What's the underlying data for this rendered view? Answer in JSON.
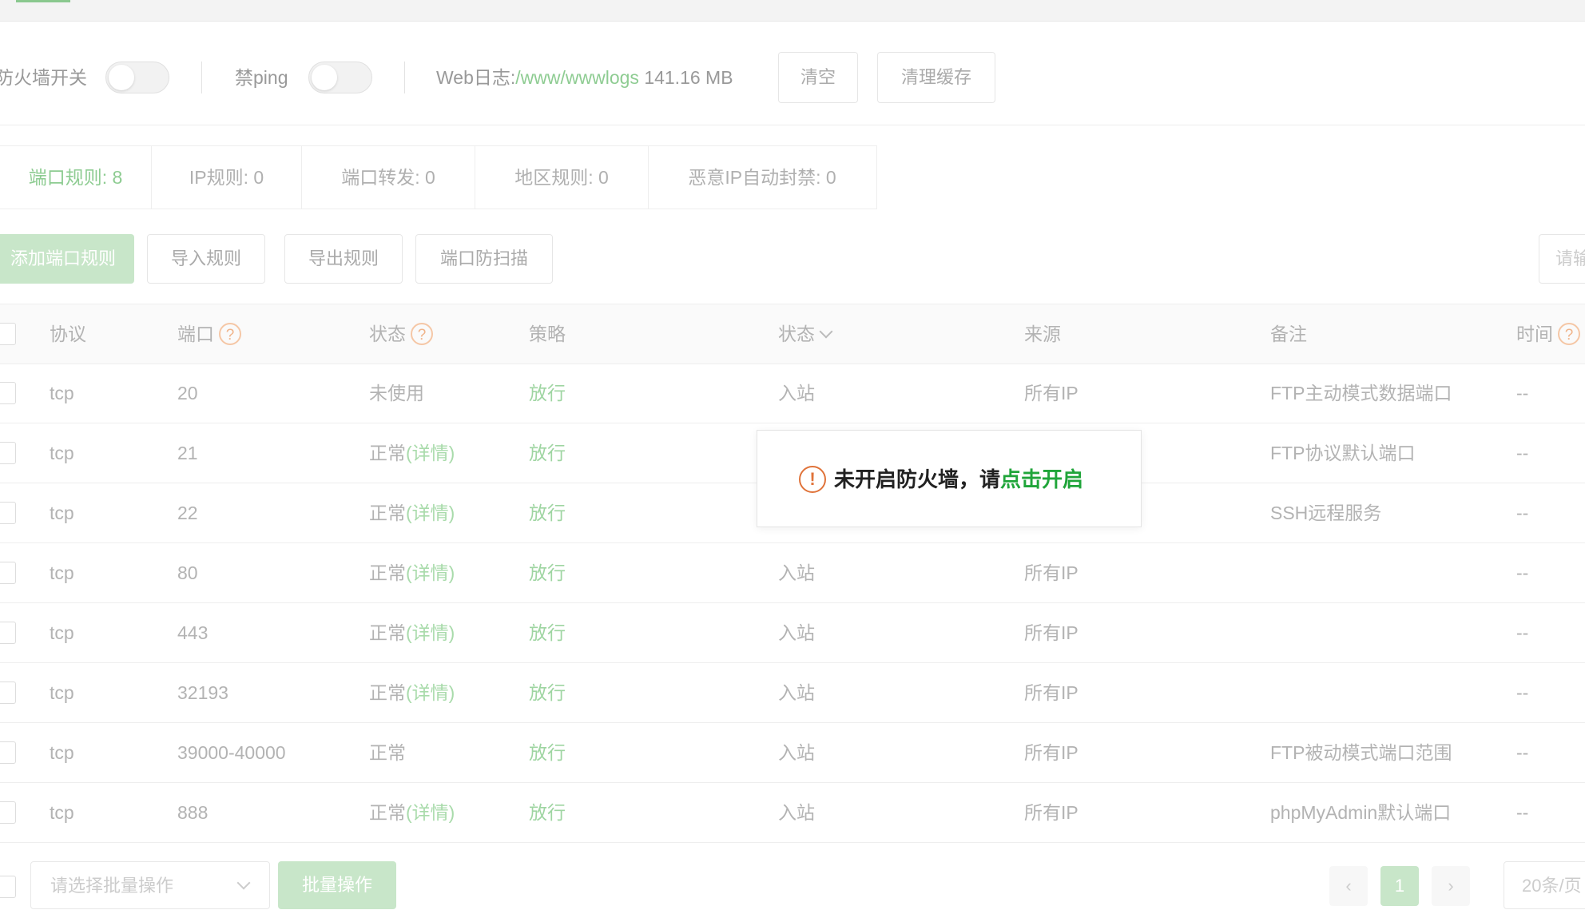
{
  "toolbar": {
    "firewall_switch_label": "防火墙开关",
    "firewall_switch_on": false,
    "ping_label": "禁ping",
    "ping_on": false,
    "weblog_label": "Web日志:",
    "weblog_path": "/www/wwwlogs",
    "weblog_size": "141.16 MB",
    "clear_label": "清空",
    "clear_cache_label": "清理缓存"
  },
  "tabs": [
    {
      "label": "端口规则: 8",
      "active": true
    },
    {
      "label": "IP规则: 0",
      "active": false
    },
    {
      "label": "端口转发: 0",
      "active": false
    },
    {
      "label": "地区规则: 0",
      "active": false
    },
    {
      "label": "恶意IP自动封禁: 0",
      "active": false
    }
  ],
  "actions": {
    "add_rule": "添加端口规则",
    "import_rules": "导入规则",
    "export_rules": "导出规则",
    "port_scan_protect": "端口防扫描",
    "search_placeholder": "请输"
  },
  "table": {
    "headers": {
      "protocol": "协议",
      "port": "端口",
      "status": "状态",
      "policy": "策略",
      "direction": "状态",
      "source": "来源",
      "remark": "备注",
      "time": "时间"
    },
    "rows": [
      {
        "protocol": "tcp",
        "port": "20",
        "status": "未使用",
        "detail": "",
        "policy": "放行",
        "direction": "入站",
        "source": "所有IP",
        "remark": "FTP主动模式数据端口",
        "time": "--"
      },
      {
        "protocol": "tcp",
        "port": "21",
        "status": "正常",
        "detail": "(详情)",
        "policy": "放行",
        "direction": "",
        "source": "",
        "remark": "FTP协议默认端口",
        "time": "--"
      },
      {
        "protocol": "tcp",
        "port": "22",
        "status": "正常",
        "detail": "(详情)",
        "policy": "放行",
        "direction": "",
        "source": "",
        "remark": "SSH远程服务",
        "time": "--"
      },
      {
        "protocol": "tcp",
        "port": "80",
        "status": "正常",
        "detail": "(详情)",
        "policy": "放行",
        "direction": "入站",
        "source": "所有IP",
        "remark": "",
        "time": "--"
      },
      {
        "protocol": "tcp",
        "port": "443",
        "status": "正常",
        "detail": "(详情)",
        "policy": "放行",
        "direction": "入站",
        "source": "所有IP",
        "remark": "",
        "time": "--"
      },
      {
        "protocol": "tcp",
        "port": "32193",
        "status": "正常",
        "detail": "(详情)",
        "policy": "放行",
        "direction": "入站",
        "source": "所有IP",
        "remark": "",
        "time": "--"
      },
      {
        "protocol": "tcp",
        "port": "39000-40000",
        "status": "正常",
        "detail": "",
        "policy": "放行",
        "direction": "入站",
        "source": "所有IP",
        "remark": "FTP被动模式端口范围",
        "time": "--"
      },
      {
        "protocol": "tcp",
        "port": "888",
        "status": "正常",
        "detail": "(详情)",
        "policy": "放行",
        "direction": "入站",
        "source": "所有IP",
        "remark": "phpMyAdmin默认端口",
        "time": "--"
      }
    ]
  },
  "footer": {
    "batch_select_placeholder": "请选择批量操作",
    "batch_button": "批量操作",
    "prev_page": "‹",
    "current_page": "1",
    "next_page": "›",
    "page_size": "20条/页"
  },
  "toast": {
    "icon_glyph": "!",
    "message": "未开启防火墙，请",
    "link_text": "点击开启"
  },
  "colors": {
    "accent_green": "#20a53a",
    "warning_orange": "#e0733a"
  }
}
